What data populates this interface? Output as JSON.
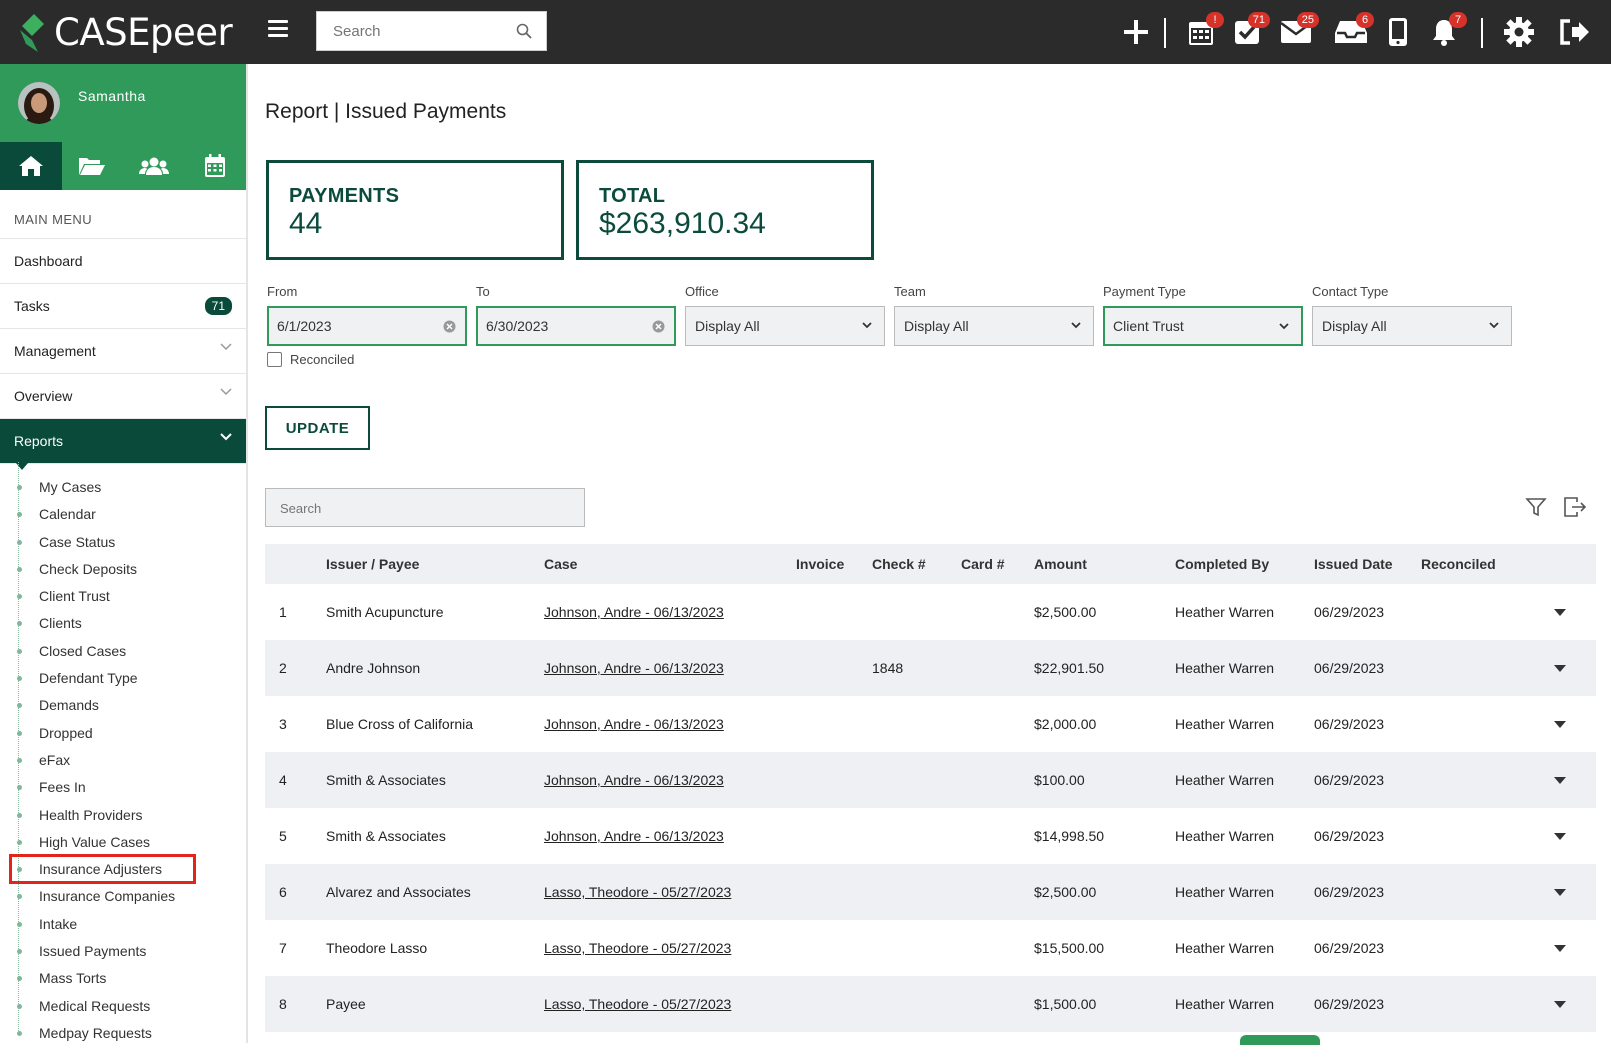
{
  "app": {
    "brand": "CASEpeer"
  },
  "topbar": {
    "search_placeholder": "Search",
    "badges": {
      "calendar": "!",
      "tasks": "71",
      "mail": "25",
      "inbox": "6",
      "notifications": "7"
    }
  },
  "sidebar": {
    "user_name": "Samantha",
    "menu_title": "MAIN MENU",
    "items": [
      {
        "label": "Dashboard"
      },
      {
        "label": "Tasks",
        "count": "71"
      },
      {
        "label": "Management"
      },
      {
        "label": "Overview"
      },
      {
        "label": "Reports"
      }
    ],
    "reports_sub": [
      "My Cases",
      "Calendar",
      "Case Status",
      "Check Deposits",
      "Client Trust",
      "Clients",
      "Closed Cases",
      "Defendant Type",
      "Demands",
      "Dropped",
      "eFax",
      "Fees In",
      "Health Providers",
      "High Value Cases",
      "Insurance Adjusters",
      "Insurance Companies",
      "Intake",
      "Issued Payments",
      "Mass Torts",
      "Medical Requests",
      "Medpay Requests"
    ]
  },
  "main": {
    "title": "Report | Issued Payments",
    "stats": {
      "payments_label": "PAYMENTS",
      "payments_value": "44",
      "total_label": "TOTAL",
      "total_value": "$263,910.34"
    },
    "filters": {
      "from_label": "From",
      "from_value": "6/1/2023",
      "to_label": "To",
      "to_value": "6/30/2023",
      "office_label": "Office",
      "office_value": "Display All",
      "team_label": "Team",
      "team_value": "Display All",
      "payment_type_label": "Payment Type",
      "payment_type_value": "Client Trust",
      "contact_type_label": "Contact Type",
      "contact_type_value": "Display All",
      "reconciled_label": "Reconciled"
    },
    "update_label": "UPDATE",
    "table_search_placeholder": "Search",
    "columns": [
      "Issuer / Payee",
      "Case",
      "Invoice",
      "Check #",
      "Card #",
      "Amount",
      "Completed By",
      "Issued Date",
      "Reconciled"
    ],
    "rows": [
      {
        "num": "1",
        "payee": "Smith Acupuncture",
        "case": "Johnson, Andre - 06/13/2023",
        "invoice": "",
        "check": "",
        "card": "",
        "amount": "$2,500.00",
        "completed_by": "Heather Warren",
        "issued": "06/29/2023",
        "reconciled": ""
      },
      {
        "num": "2",
        "payee": "Andre Johnson",
        "case": "Johnson, Andre - 06/13/2023",
        "invoice": "",
        "check": "1848",
        "card": "",
        "amount": "$22,901.50",
        "completed_by": "Heather Warren",
        "issued": "06/29/2023",
        "reconciled": ""
      },
      {
        "num": "3",
        "payee": "Blue Cross of California",
        "case": "Johnson, Andre - 06/13/2023",
        "invoice": "",
        "check": "",
        "card": "",
        "amount": "$2,000.00",
        "completed_by": "Heather Warren",
        "issued": "06/29/2023",
        "reconciled": ""
      },
      {
        "num": "4",
        "payee": "Smith & Associates",
        "case": "Johnson, Andre - 06/13/2023",
        "invoice": "",
        "check": "",
        "card": "",
        "amount": "$100.00",
        "completed_by": "Heather Warren",
        "issued": "06/29/2023",
        "reconciled": ""
      },
      {
        "num": "5",
        "payee": "Smith & Associates",
        "case": "Johnson, Andre - 06/13/2023",
        "invoice": "",
        "check": "",
        "card": "",
        "amount": "$14,998.50",
        "completed_by": "Heather Warren",
        "issued": "06/29/2023",
        "reconciled": ""
      },
      {
        "num": "6",
        "payee": "Alvarez and Associates",
        "case": "Lasso, Theodore - 05/27/2023",
        "invoice": "",
        "check": "",
        "card": "",
        "amount": "$2,500.00",
        "completed_by": "Heather Warren",
        "issued": "06/29/2023",
        "reconciled": ""
      },
      {
        "num": "7",
        "payee": "Theodore Lasso",
        "case": "Lasso, Theodore - 05/27/2023",
        "invoice": "",
        "check": "",
        "card": "",
        "amount": "$15,500.00",
        "completed_by": "Heather Warren",
        "issued": "06/29/2023",
        "reconciled": ""
      },
      {
        "num": "8",
        "payee": "Payee",
        "case": "Lasso, Theodore - 05/27/2023",
        "invoice": "",
        "check": "",
        "card": "",
        "amount": "$1,500.00",
        "completed_by": "Heather Warren",
        "issued": "06/29/2023",
        "reconciled": ""
      }
    ]
  },
  "colors": {
    "brand_green": "#2f9a5a",
    "dark_green": "#0b4b3c",
    "topbar": "#2b2b2b",
    "badge_red": "#d6322a",
    "highlight": "#e0261b"
  }
}
